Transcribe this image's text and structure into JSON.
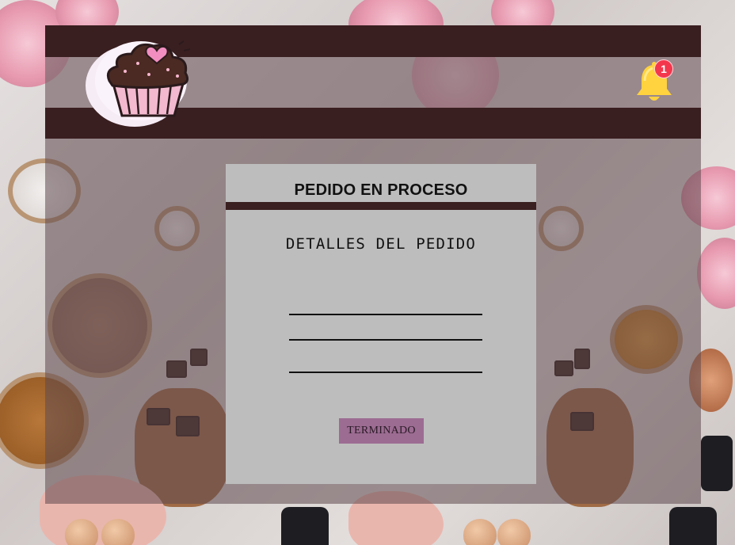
{
  "header": {
    "logo_icon": "cupcake-icon",
    "notifications": {
      "icon": "bell-icon",
      "count": "1"
    }
  },
  "card": {
    "title": "PEDIDO EN PROCESO",
    "subtitle": "DETALLES DEL PEDIDO",
    "complete_button_label": "TERMINADO"
  },
  "colors": {
    "header_bar": "#3a1f20",
    "card_background": "#bdbdbd",
    "button": "#9c6c92",
    "badge": "#f4364c",
    "bell": "#ffd23f"
  }
}
